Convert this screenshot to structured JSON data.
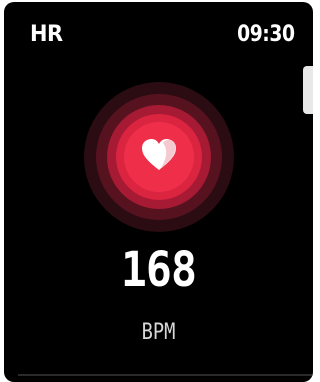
{
  "header": {
    "title": "HR",
    "time": "09:30"
  },
  "heart_rate": {
    "value": "168",
    "unit": "BPM"
  },
  "icons": {
    "heart": "heart-icon"
  },
  "colors": {
    "background": "#000000",
    "accent": "#ef2f4a",
    "text": "#ffffff"
  }
}
